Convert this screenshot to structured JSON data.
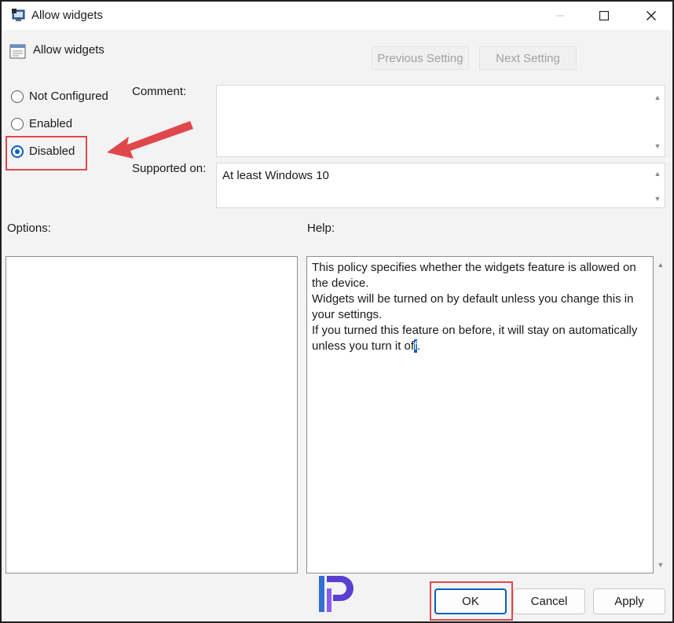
{
  "window": {
    "title": "Allow widgets"
  },
  "policy": {
    "name": "Allow widgets"
  },
  "nav": {
    "previous_label": "Previous Setting",
    "next_label": "Next Setting"
  },
  "state": {
    "options": [
      {
        "label": "Not Configured",
        "checked": false
      },
      {
        "label": "Enabled",
        "checked": false
      },
      {
        "label": "Disabled",
        "checked": true
      }
    ]
  },
  "comment": {
    "label": "Comment:",
    "value": ""
  },
  "supported": {
    "label": "Supported on:",
    "value": "At least Windows 10"
  },
  "options_pane": {
    "label": "Options:"
  },
  "help_pane": {
    "label": "Help:",
    "lines": [
      "This policy specifies whether the widgets feature is allowed on the device.",
      "Widgets will be turned on by default unless you change this in your settings.",
      "If you turned this feature on before, it will stay on automatically unless you turn it of",
      "f",
      "."
    ]
  },
  "buttons": {
    "ok": "OK",
    "cancel": "Cancel",
    "apply": "Apply"
  },
  "colors": {
    "accent": "#0a5fbd",
    "annotation": "#e0474c"
  },
  "icons": {
    "title": "policy-editor-icon",
    "policy": "policy-setting-icon",
    "minimize": "minimize-icon",
    "maximize": "maximize-icon",
    "close": "close-icon",
    "logo": "brand-logo-icon"
  }
}
